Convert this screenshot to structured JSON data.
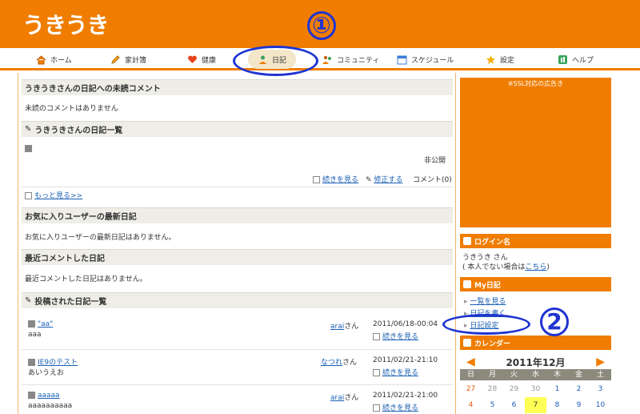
{
  "app": {
    "logo": "うきうき"
  },
  "nav": [
    {
      "label": "ホーム",
      "icon": "home-icon"
    },
    {
      "label": "家計簿",
      "icon": "pencil-icon"
    },
    {
      "label": "健康",
      "icon": "heart-icon"
    },
    {
      "label": "日記",
      "icon": "person-icon"
    },
    {
      "label": "コミュニティ",
      "icon": "community-icon"
    },
    {
      "label": "スケジュール",
      "icon": "calendar-icon"
    },
    {
      "label": "設定",
      "icon": "star-icon"
    },
    {
      "label": "ヘルプ",
      "icon": "help-icon"
    }
  ],
  "sections": {
    "unread_title": "うきうきさんの日記への未読コメント",
    "unread_text": "未読のコメントはありません",
    "diary_list_title": "うきうきさんの日記一覧",
    "private_label": "非公開",
    "read_more": "続きを見る",
    "edit": "修正する",
    "comment_count": "コメント(0)",
    "see_more": "もっと見る>>",
    "fav_title": "お気に入りユーザーの最新日記",
    "fav_text": "お気に入りユーザーの最新日記はありません。",
    "recent_title": "最近コメントした日記",
    "recent_text": "最近コメントした日記はありません。",
    "posted_title": "投稿された日記一覧"
  },
  "posts": [
    {
      "title": "\"aa\"",
      "body": "aaa",
      "author": "arai",
      "suffix": "さん",
      "date": "2011/06/18-00:04",
      "read_more": "続きを見る"
    },
    {
      "title": "IE9のテスト",
      "body": "あいうえお",
      "author": "なつれ",
      "suffix": "さん",
      "date": "2011/02/21-21:10",
      "read_more": "続きを見る"
    },
    {
      "title": "aaaaa",
      "body": "aaaaaaaaaa",
      "author": "arai",
      "suffix": "さん",
      "date": "2011/02/21-21:00",
      "read_more": "続きを見る"
    }
  ],
  "sidebar": {
    "ad_label": "※SSL対応の広告き",
    "login_title": "ログイン名",
    "login_name": "うきうき さん",
    "login_note_pre": "( 本人でない場合は",
    "login_note_link": "こちら",
    "login_note_post": ")",
    "mydiary_title": "My日記",
    "links": [
      "一覧を見る",
      "日記を書く",
      "日記設定"
    ],
    "calendar_title": "カレンダー",
    "calendar_month": "2011年12月",
    "weekdays": [
      "日",
      "月",
      "火",
      "水",
      "木",
      "金",
      "土"
    ],
    "week1": [
      "27",
      "28",
      "29",
      "30",
      "1",
      "2",
      "3"
    ],
    "week2": [
      "4",
      "5",
      "6",
      "7",
      "8",
      "9",
      "10"
    ]
  },
  "annotations": {
    "one": "①",
    "two": "2"
  },
  "colors": {
    "orange": "#f07d00",
    "annot_blue": "#1f34d1",
    "link": "#1a5fb4"
  }
}
